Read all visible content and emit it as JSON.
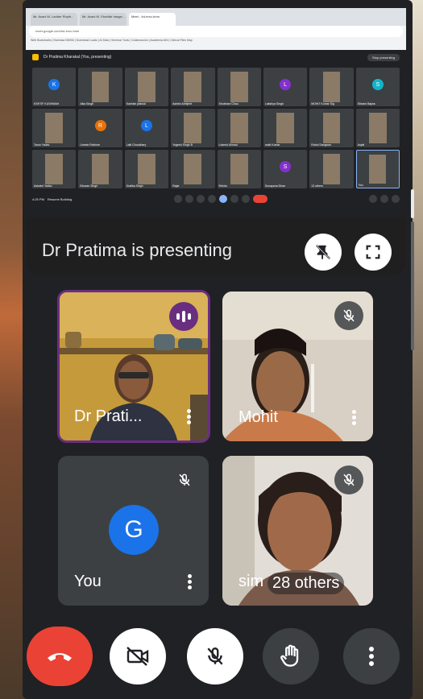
{
  "shared_screen": {
    "tabs": [
      "Mr. Avani M. Ladder Rhyth...",
      "Mr. Avani M. Shortlist Image...",
      "Meet - fot-erxv-bnm"
    ],
    "address": "meet.google.com/fot-erxv-bnm",
    "bookmarks": "Web Bookmarks  |  Harivasa NMKM  |  Download Loads  |  AI Data  |  Seminar Tools  |  Colaboracion  |  Academia AIN  |  Clinical Files Map",
    "meet_title": "Dr Pratima Kharakal (You, presenting)",
    "meet_pres_label": "Stop presenting",
    "participants": [
      {
        "name": "KSHTIF KUSHWAH",
        "avatar": "K",
        "color": "#1a73e8"
      },
      {
        "name": "Alka Singh",
        "avatar": "",
        "color": ""
      },
      {
        "name": "Kashish jaiswal",
        "avatar": "",
        "color": ""
      },
      {
        "name": "Ashish Abhijeet",
        "avatar": "",
        "color": ""
      },
      {
        "name": "Shubham Chau",
        "avatar": "",
        "color": ""
      },
      {
        "name": "Lakshya Singh",
        "avatar": "L",
        "color": "#8430ce"
      },
      {
        "name": "MOHIT Kumar Sig",
        "avatar": "",
        "color": ""
      },
      {
        "name": "Shivani Bajwa",
        "avatar": "S",
        "color": "#12b5cb"
      },
      {
        "name": "Tarun Yadav",
        "avatar": "",
        "color": ""
      },
      {
        "name": "Umesh Rathore",
        "avatar": "R",
        "color": "#e8710a"
      },
      {
        "name": "Lalit Choudhary",
        "avatar": "L",
        "color": "#1a73e8"
      },
      {
        "name": "Yogesh Singh B",
        "avatar": "",
        "color": ""
      },
      {
        "name": "Lokesh Ahmad",
        "avatar": "",
        "color": ""
      },
      {
        "name": "ankit Kumar",
        "avatar": "",
        "color": ""
      },
      {
        "name": "Rahul Sangwan",
        "avatar": "",
        "color": ""
      },
      {
        "name": "Anjali",
        "avatar": "",
        "color": ""
      },
      {
        "name": "Ashwini Yadav",
        "avatar": "",
        "color": ""
      },
      {
        "name": "Bhuvan Singh",
        "avatar": "",
        "color": ""
      },
      {
        "name": "Kratika Singh",
        "avatar": "",
        "color": ""
      },
      {
        "name": "Rajat",
        "avatar": "",
        "color": ""
      },
      {
        "name": "Rekha",
        "avatar": "",
        "color": ""
      },
      {
        "name": "Sunayana Dhan",
        "avatar": "S",
        "color": "#8430ce"
      },
      {
        "name": "13 others",
        "avatar": "",
        "color": ""
      },
      {
        "name": "You",
        "avatar": "",
        "color": ""
      }
    ],
    "meet_time": "4:25 PM",
    "meet_room": "Resume Building"
  },
  "presenting": {
    "text": "Dr Pratima is presenting"
  },
  "tiles": [
    {
      "name": "Dr Prati...",
      "state": "speaking"
    },
    {
      "name": "Mohit",
      "state": "muted"
    },
    {
      "name": "You",
      "state": "muted",
      "avatar": "G"
    },
    {
      "name": "sim",
      "state": "muted",
      "others": "28 others"
    }
  ],
  "colors": {
    "end_call": "#ea4335",
    "speaking_ring": "#6a2e80",
    "avatar_blue": "#1a73e8"
  }
}
